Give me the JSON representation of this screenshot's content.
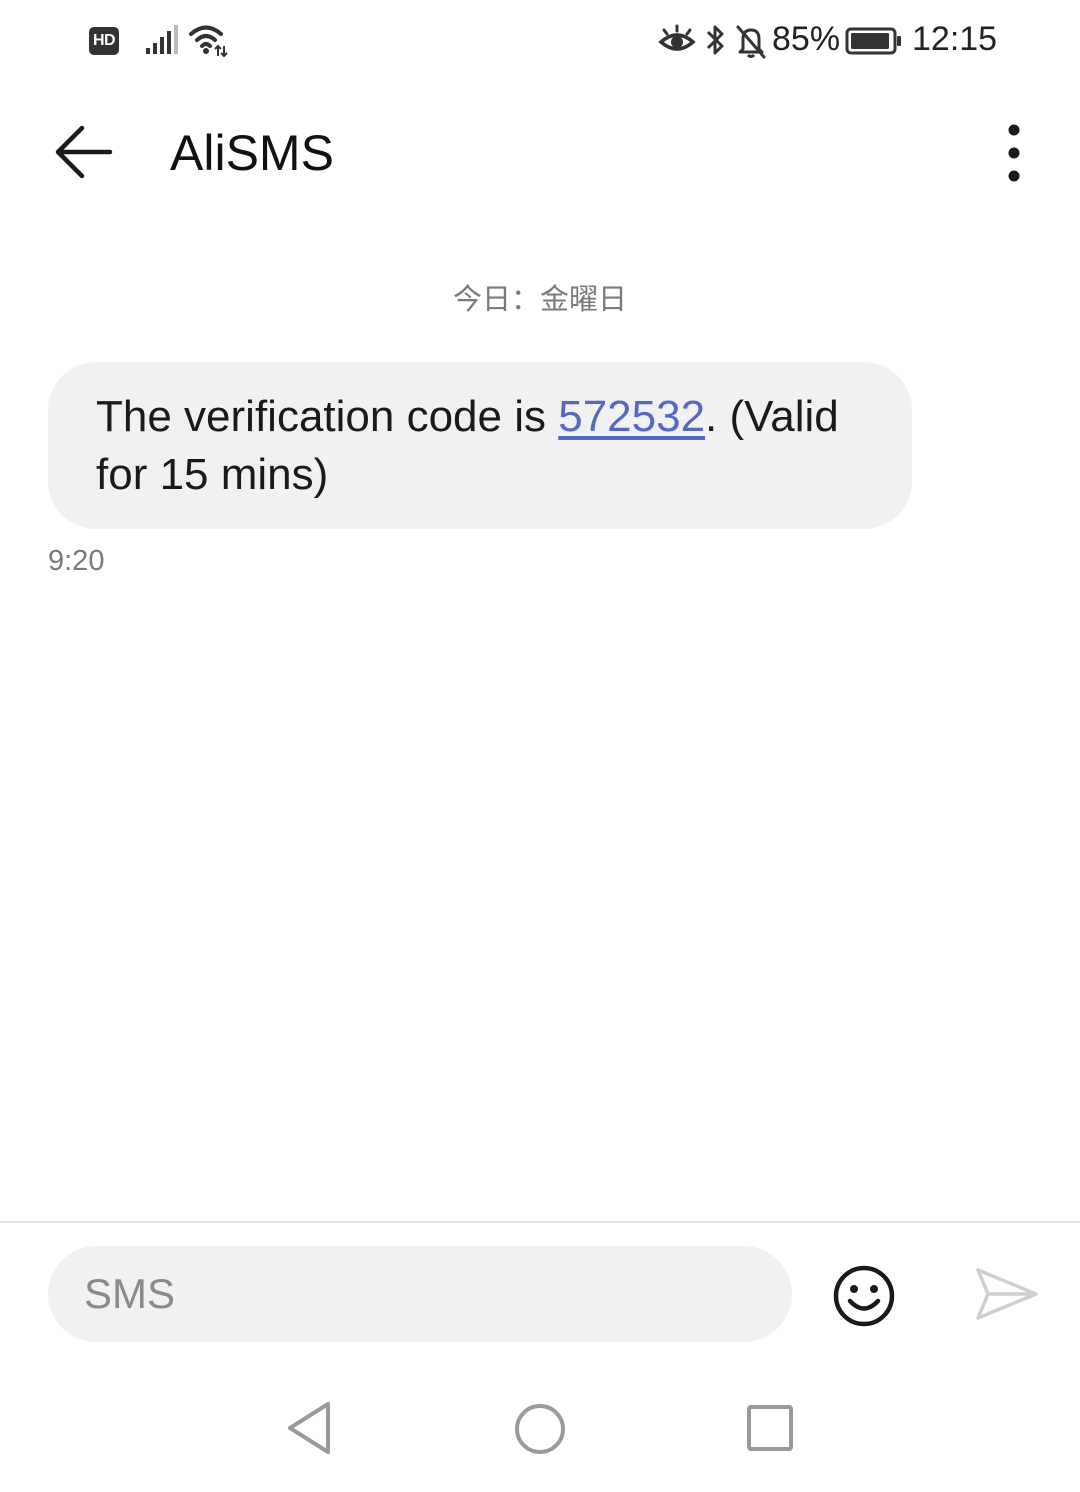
{
  "status_bar": {
    "hd_label": "HD",
    "battery_percent": "85%",
    "time": "12:15",
    "icons": [
      "hd-icon",
      "signal-icon",
      "wifi-icon",
      "eye-comfort-icon",
      "bluetooth-icon",
      "bell-off-icon",
      "battery-icon"
    ]
  },
  "header": {
    "contact_name": "AliSMS",
    "icons": [
      "back-arrow-icon",
      "more-vertical-icon"
    ]
  },
  "conversation": {
    "date_label": "今日：金曜日",
    "messages": [
      {
        "text_before": "The verification code is ",
        "code": "572532",
        "text_after": ". (Valid for 15 mins)",
        "time": "9:20"
      }
    ]
  },
  "composer": {
    "placeholder": "SMS",
    "icons": [
      "emoji-icon",
      "send-icon"
    ]
  },
  "nav_bar": {
    "icons": [
      "nav-back-icon",
      "nav-home-icon",
      "nav-recents-icon"
    ]
  },
  "colors": {
    "bubble_bg": "#f1f1f1",
    "link": "#5568c4",
    "muted_text": "#7a7a7a"
  }
}
